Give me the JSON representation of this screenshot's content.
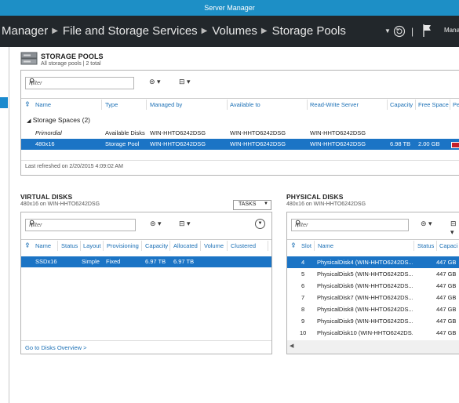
{
  "window": {
    "title": "Server Manager"
  },
  "header": {
    "breadcrumbs": [
      "Manager",
      "File and Storage Services",
      "Volumes",
      "Storage Pools"
    ],
    "manage_label": "Manag"
  },
  "storage_pools": {
    "title": "STORAGE POOLS",
    "subtitle": "All storage pools | 2 total",
    "filter_placeholder": "Filter",
    "columns": [
      "Name",
      "Type",
      "Managed by",
      "Available to",
      "Read-Write Server",
      "Capacity",
      "Free Space",
      "Pe"
    ],
    "group_label": "Storage Spaces (2)",
    "rows": [
      {
        "name": "Primordial",
        "type": "Available Disks",
        "managed_by": "WIN-HHTO6242DSG",
        "available_to": "WIN-HHTO6242DSG",
        "rw_server": "WIN-HHTO6242DSG",
        "capacity": "",
        "free_space": ""
      },
      {
        "name": "480x16",
        "type": "Storage Pool",
        "managed_by": "WIN-HHTO6242DSG",
        "available_to": "WIN-HHTO6242DSG",
        "rw_server": "WIN-HHTO6242DSG",
        "capacity": "6.98 TB",
        "free_space": "2.00 GB"
      }
    ],
    "refreshed": "Last refreshed on 2/20/2015 4:09:02 AM"
  },
  "virtual_disks": {
    "title": "VIRTUAL DISKS",
    "subtitle": "480x16 on WIN-HHTO6242DSG",
    "tasks_label": "TASKS",
    "filter_placeholder": "Filter",
    "columns": [
      "Name",
      "Status",
      "Layout",
      "Provisioning",
      "Capacity",
      "Allocated",
      "Volume",
      "Clustered"
    ],
    "rows": [
      {
        "name": "SSDx16",
        "status": "",
        "layout": "Simple",
        "provisioning": "Fixed",
        "capacity": "6.97 TB",
        "allocated": "6.97 TB",
        "volume": "",
        "clustered": ""
      }
    ],
    "link": "Go to Disks Overview >"
  },
  "physical_disks": {
    "title": "PHYSICAL DISKS",
    "subtitle": "480x16 on WIN-HHTO6242DSG",
    "filter_placeholder": "Filter",
    "columns": [
      "Slot",
      "Name",
      "Status",
      "Capaci"
    ],
    "rows": [
      {
        "slot": "4",
        "name": "PhysicalDisk4 (WIN-HHTO6242DS...",
        "capacity": "447 GB"
      },
      {
        "slot": "5",
        "name": "PhysicalDisk5 (WIN-HHTO6242DS...",
        "capacity": "447 GB"
      },
      {
        "slot": "6",
        "name": "PhysicalDisk6 (WIN-HHTO6242DS...",
        "capacity": "447 GB"
      },
      {
        "slot": "7",
        "name": "PhysicalDisk7 (WIN-HHTO6242DS...",
        "capacity": "447 GB"
      },
      {
        "slot": "8",
        "name": "PhysicalDisk8 (WIN-HHTO6242DS...",
        "capacity": "447 GB"
      },
      {
        "slot": "9",
        "name": "PhysicalDisk9 (WIN-HHTO6242DS...",
        "capacity": "447 GB"
      },
      {
        "slot": "10",
        "name": "PhysicalDisk10 (WIN-HHTO6242DS...",
        "capacity": "447 GB"
      }
    ]
  },
  "colors": {
    "accent": "#1b74c5",
    "titlebar": "#1d8fc6",
    "header": "#22272b",
    "link": "#1a6fb5",
    "bar_red": "#c4202a"
  }
}
